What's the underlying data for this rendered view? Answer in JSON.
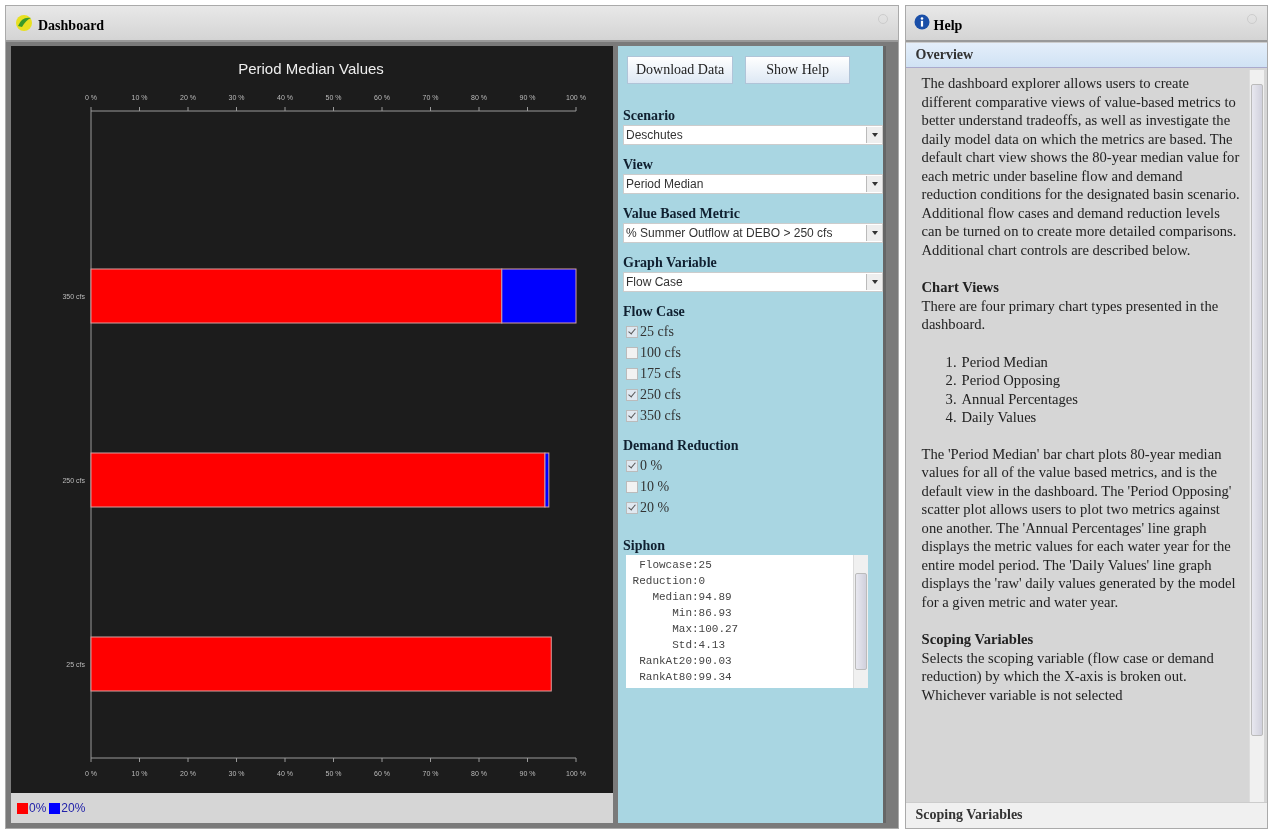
{
  "dashboard": {
    "title": "Dashboard",
    "chart": {
      "chart_data": {
        "type": "bar",
        "orientation": "horizontal",
        "stacked": true,
        "title": "Period Median Values",
        "categories": [
          "350 cfs",
          "250 cfs",
          "25 cfs"
        ],
        "series": [
          {
            "name": "0%",
            "color": "#ff0000",
            "values": [
              84.7,
              93.6,
              94.9
            ]
          },
          {
            "name": "20%",
            "color": "#0000ff",
            "values": [
              15.3,
              0.8,
              null
            ]
          }
        ],
        "xlim": [
          0,
          100
        ],
        "legend": "bottom",
        "xticks": [
          {
            "value": 0,
            "label": "0 %"
          },
          {
            "value": 10,
            "label": "10 %"
          },
          {
            "value": 20,
            "label": "20 %"
          },
          {
            "value": 30,
            "label": "30 %"
          },
          {
            "value": 40,
            "label": "40 %"
          },
          {
            "value": 50,
            "label": "50 %"
          },
          {
            "value": 60,
            "label": "60 %"
          },
          {
            "value": 70,
            "label": "70 %"
          },
          {
            "value": 80,
            "label": "80 %"
          },
          {
            "value": 90,
            "label": "90 %"
          },
          {
            "value": 100,
            "label": "100 %"
          }
        ]
      }
    },
    "controls": {
      "buttons": [
        "Download Data",
        "Show Help"
      ],
      "selects": [
        {
          "label": "Scenario",
          "value": "Deschutes"
        },
        {
          "label": "View",
          "value": "Period Median"
        },
        {
          "label": "Value Based Metric",
          "value": "% Summer Outflow at DEBO > 250 cfs"
        },
        {
          "label": "Graph Variable",
          "value": "Flow Case"
        }
      ],
      "checkgroups": [
        {
          "label": "Flow Case",
          "options": [
            {
              "label": "25 cfs",
              "checked": true
            },
            {
              "label": "100 cfs",
              "checked": false
            },
            {
              "label": "175 cfs",
              "checked": false
            },
            {
              "label": "250 cfs",
              "checked": true
            },
            {
              "label": "350 cfs",
              "checked": true
            }
          ]
        },
        {
          "label": "Demand Reduction",
          "options": [
            {
              "label": "0 %",
              "checked": true
            },
            {
              "label": "10 %",
              "checked": false
            },
            {
              "label": "20 %",
              "checked": true
            }
          ]
        }
      ],
      "siphon": {
        "label": "Siphon",
        "lines": [
          "  Flowcase:25",
          " Reduction:0",
          "    Median:94.89",
          "       Min:86.93",
          "       Max:100.27",
          "       Std:4.13",
          "  RankAt20:90.03",
          "  RankAt80:99.34"
        ]
      }
    }
  },
  "help": {
    "title": "Help",
    "sections": [
      {
        "title": "Overview",
        "expanded": true,
        "blocks": [
          {
            "kind": "paragraph",
            "text": "The dashboard explorer allows users to create different comparative views of value-based metrics to better understand tradeoffs, as well as investigate the daily model data on which the metrics are based. The default chart view shows the 80-year median value for each metric under baseline flow and demand reduction conditions for the designated basin scenario. Additional flow cases and demand reduction levels can be turned on to create more detailed comparisons. Additional chart controls are described below."
          },
          {
            "kind": "heading",
            "text": "Chart Views"
          },
          {
            "kind": "paragraph",
            "text": "There are four primary chart types presented in the dashboard."
          },
          {
            "kind": "list",
            "items": [
              {
                "number": "1.",
                "text": "Period Median"
              },
              {
                "number": "2.",
                "text": "Period Opposing"
              },
              {
                "number": "3.",
                "text": "Annual Percentages"
              },
              {
                "number": "4.",
                "text": "Daily Values"
              }
            ]
          },
          {
            "kind": "paragraph",
            "text": "The 'Period Median' bar chart plots 80-year median values for all of the value based metrics, and is the default view in the dashboard. The 'Period Opposing' scatter plot allows users to plot two metrics against one another. The 'Annual Percentages' line graph displays the metric values for each water year for the entire model period. The 'Daily Values' line graph displays the 'raw' daily values generated by the model for a given metric and water year."
          },
          {
            "kind": "heading",
            "text": "Scoping Variables"
          },
          {
            "kind": "paragraph",
            "text": "Selects the scoping variable (flow case or demand reduction) by which the X-axis is broken out. Whichever variable is not selected"
          }
        ]
      },
      {
        "title": "Scoping Variables",
        "expanded": false
      }
    ]
  }
}
